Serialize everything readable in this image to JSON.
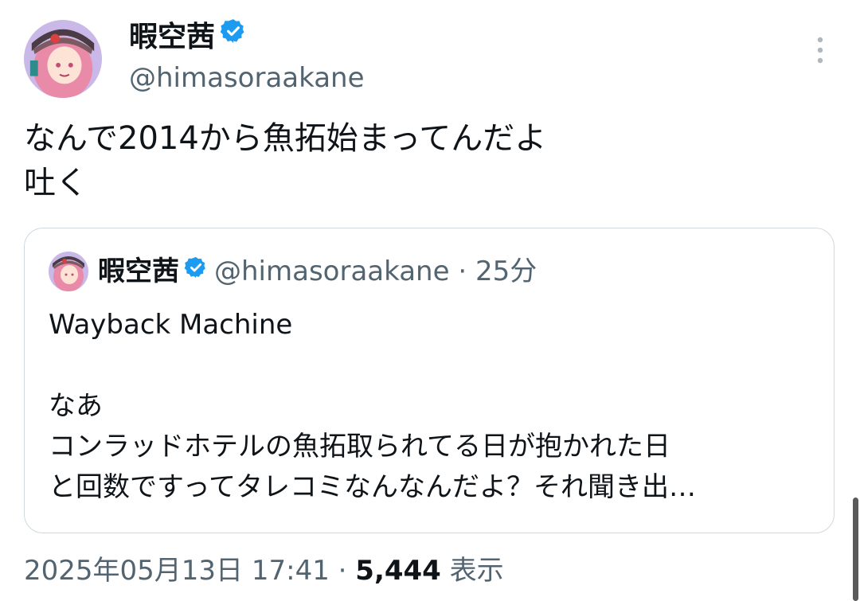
{
  "author": {
    "display_name": "暇空茜",
    "handle": "@himasoraakane",
    "verified": true
  },
  "tweet": {
    "text": "なんで2014から魚拓始まってんだよ\n吐く",
    "date": "2025年05月13日 17:41",
    "separator": "·",
    "views_count": "5,444",
    "views_label": "表示"
  },
  "quote": {
    "display_name": "暇空茜",
    "handle": "@himasoraakane",
    "separator": "·",
    "time": "25分",
    "lines": [
      "Wayback Machine",
      "",
      "なあ",
      "コンラッドホテルの魚拓取られてる日が抱かれた日",
      "と回数ですってタレコミなんなんだよ？それ聞き出…"
    ]
  },
  "icons": {
    "verified": "verified-badge-icon",
    "more": "more-vertical-icon"
  },
  "colors": {
    "text": "#0f1419",
    "secondary": "#536471",
    "verified": "#1d9bf0",
    "border": "#cfd9de"
  }
}
